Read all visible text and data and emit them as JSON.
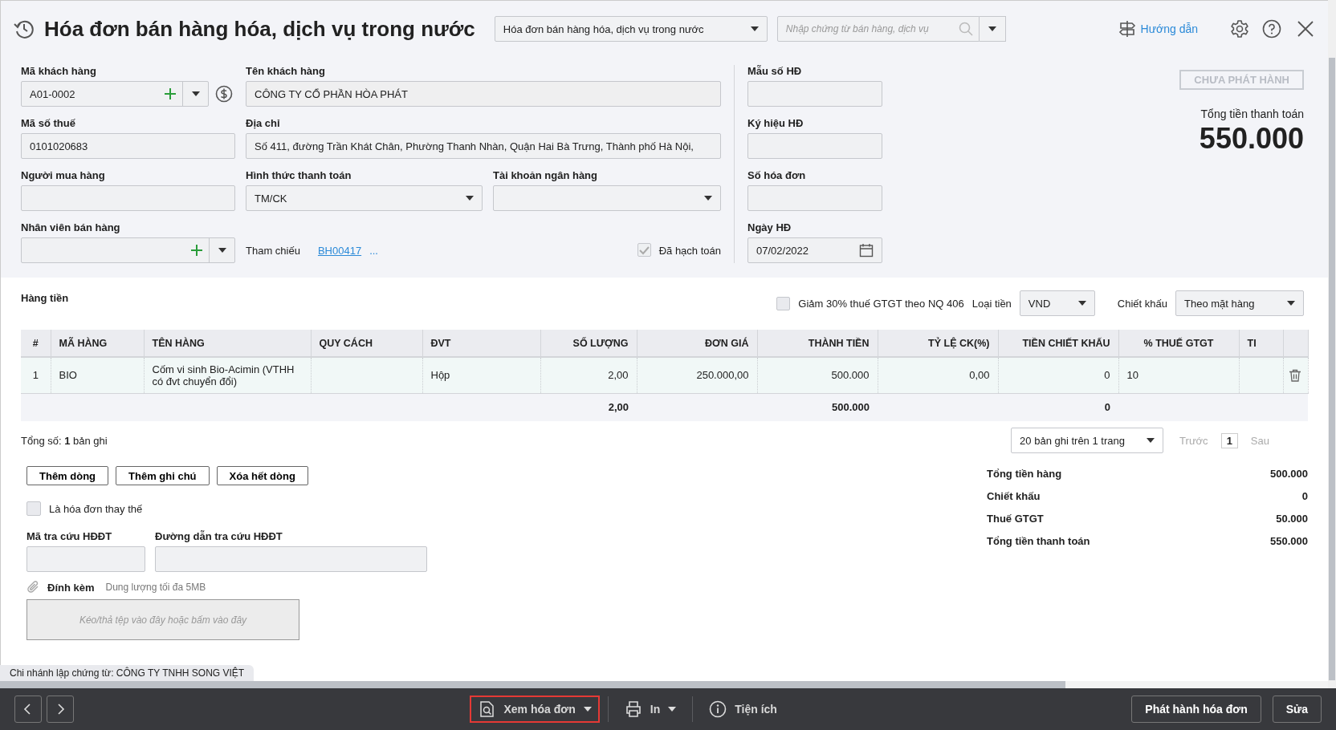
{
  "header": {
    "title": "Hóa đơn bán hàng hóa, dịch vụ trong nước",
    "type_select": {
      "value": "Hóa đơn bán hàng hóa, dịch vụ trong nước"
    },
    "search": {
      "placeholder": "Nhập chứng từ bán hàng, dịch vụ"
    },
    "guide_link": "Hướng dẫn"
  },
  "form": {
    "customer_code": {
      "label": "Mã khách hàng",
      "value": "A01-0002"
    },
    "customer_name": {
      "label": "Tên khách hàng",
      "value": "CÔNG TY CỔ PHẦN HÒA PHÁT"
    },
    "tax_code": {
      "label": "Mã số thuế",
      "value": "0101020683"
    },
    "address": {
      "label": "Địa chỉ",
      "value": "Số 411, đường Trần Khát Chân, Phường Thanh Nhàn, Quận Hai Bà Trưng, Thành phố Hà Nội,"
    },
    "buyer": {
      "label": "Người mua hàng"
    },
    "payment_method": {
      "label": "Hình thức thanh toán",
      "value": "TM/CK"
    },
    "bank_account": {
      "label": "Tài khoản ngân hàng"
    },
    "salesperson": {
      "label": "Nhân viên bán hàng"
    },
    "reference": {
      "label": "Tham chiếu",
      "link": "BH00417",
      "more": "..."
    },
    "posted": {
      "label": "Đã hạch toán",
      "checked": true
    },
    "invoice_template": {
      "label": "Mẫu số HĐ"
    },
    "invoice_symbol": {
      "label": "Ký hiệu HĐ"
    },
    "invoice_number": {
      "label": "Số hóa đơn"
    },
    "invoice_date": {
      "label": "Ngày HĐ",
      "value": "07/02/2022"
    }
  },
  "status": {
    "badge": "CHƯA PHÁT HÀNH",
    "total_label": "Tổng tiền thanh toán",
    "total": "550.000"
  },
  "lines": {
    "title": "Hàng tiền",
    "vat_reduction": {
      "label": "Giảm 30% thuế GTGT theo NQ 406",
      "checked": false
    },
    "currency": {
      "label": "Loại tiền",
      "value": "VND"
    },
    "discount": {
      "label": "Chiết khấu",
      "value": "Theo mặt hàng"
    },
    "table": {
      "columns": [
        "#",
        "MÃ HÀNG",
        "TÊN HÀNG",
        "QUY CÁCH",
        "ĐVT",
        "SỐ LƯỢNG",
        "ĐƠN GIÁ",
        "THÀNH TIỀN",
        "TỶ LỆ CK(%)",
        "TIỀN CHIẾT KHẤU",
        "% THUẾ GTGT",
        "TI"
      ],
      "rows": [
        {
          "no": "1",
          "item_code": "BIO",
          "item_name": "Cốm vi sinh Bio-Acimin (VTHH có đvt chuyển đổi)",
          "unit": "Hộp",
          "quantity": "2,00",
          "unit_price": "250.000,00",
          "amount": "500.000",
          "discount_rate": "0,00",
          "discount_amount": "0",
          "vat_rate": "10"
        }
      ],
      "totals": {
        "quantity": "2,00",
        "amount": "500.000",
        "discount_amount": "0"
      }
    },
    "record_count": "Tổng số: **1** bản ghi",
    "pager": {
      "page_size": "20 bản ghi trên 1 trang",
      "prev": "Trước",
      "page": "1",
      "next": "Sau"
    },
    "buttons": [
      "Thêm dòng",
      "Thêm ghi chú",
      "Xóa hết dòng"
    ]
  },
  "replacement": {
    "label": "Là hóa đơn thay thế",
    "checked": false
  },
  "lookup_code": {
    "label": "Mã tra cứu HĐĐT"
  },
  "lookup_link": {
    "label": "Đường dẫn tra cứu HĐĐT"
  },
  "attachment": {
    "label": "Đính kèm",
    "hint": "Dung lượng tối đa 5MB",
    "dropzone": "Kéo/thả tệp vào đây hoặc bấm vào đây"
  },
  "summary": [
    {
      "label": "Tổng tiền hàng",
      "value": "500.000"
    },
    {
      "label": "Chiết khấu",
      "value": "0"
    },
    {
      "label": "Thuế GTGT",
      "value": "50.000"
    },
    {
      "label": "Tổng tiền thanh toán",
      "value": "550.000"
    }
  ],
  "branch_note": "Chi nhánh lập chứng từ: CÔNG TY TNHH SONG VIỆT",
  "toolbar": {
    "actions": [
      {
        "kind": "preview",
        "label": "Xem hóa đơn",
        "dropdown": true,
        "highlighted": true
      },
      {
        "kind": "print",
        "label": "In",
        "dropdown": true,
        "highlighted": false
      },
      {
        "kind": "utilities",
        "label": "Tiện ích",
        "dropdown": false,
        "highlighted": false
      }
    ],
    "buttons": [
      "Phát hành hóa đơn",
      "Sửa"
    ]
  }
}
